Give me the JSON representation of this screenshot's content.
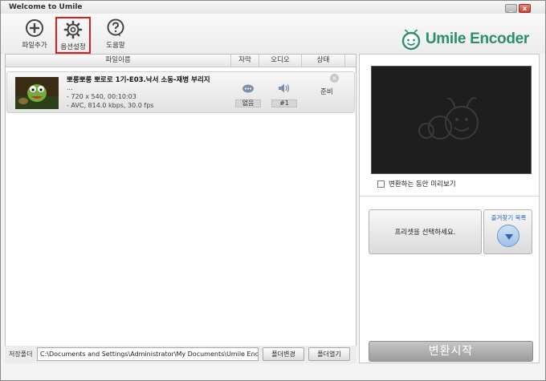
{
  "window": {
    "title": "Welcome to Umile"
  },
  "toolbar": {
    "add_file": "파일추가",
    "options": "옵션설정",
    "help": "도움말"
  },
  "brand": {
    "logo_text": "Umile Encoder",
    "accent": "#2a8f6a"
  },
  "columns": {
    "filename": "파일이름",
    "subtitle": "자막",
    "audio": "오디오",
    "status": "상태"
  },
  "file": {
    "name": "뽀롱뽀롱 뽀로로 1기-E03.낙서 소동-재병 부리지",
    "ellipsis": "...",
    "resolution": "- 720 x 540, 00:10:03",
    "codec": "- AVC, 814.0 kbps, 30.0 fps",
    "subtitle_value": "없음",
    "audio_value": "#1",
    "status": "준비"
  },
  "save": {
    "label": "저장폴더",
    "path": "C:\\Documents and Settings\\Administrator\\My Documents\\Umile Encoder",
    "change_folder": "폴더변경",
    "open_folder": "폴더열기"
  },
  "preview": {
    "checkbox_label": "변환하는 동안 미리보기",
    "checked": false
  },
  "preset": {
    "select_label": "프리셋을 선택하세요.",
    "favorites_label": "즐겨찾기 목록"
  },
  "start_button": "변환시작"
}
